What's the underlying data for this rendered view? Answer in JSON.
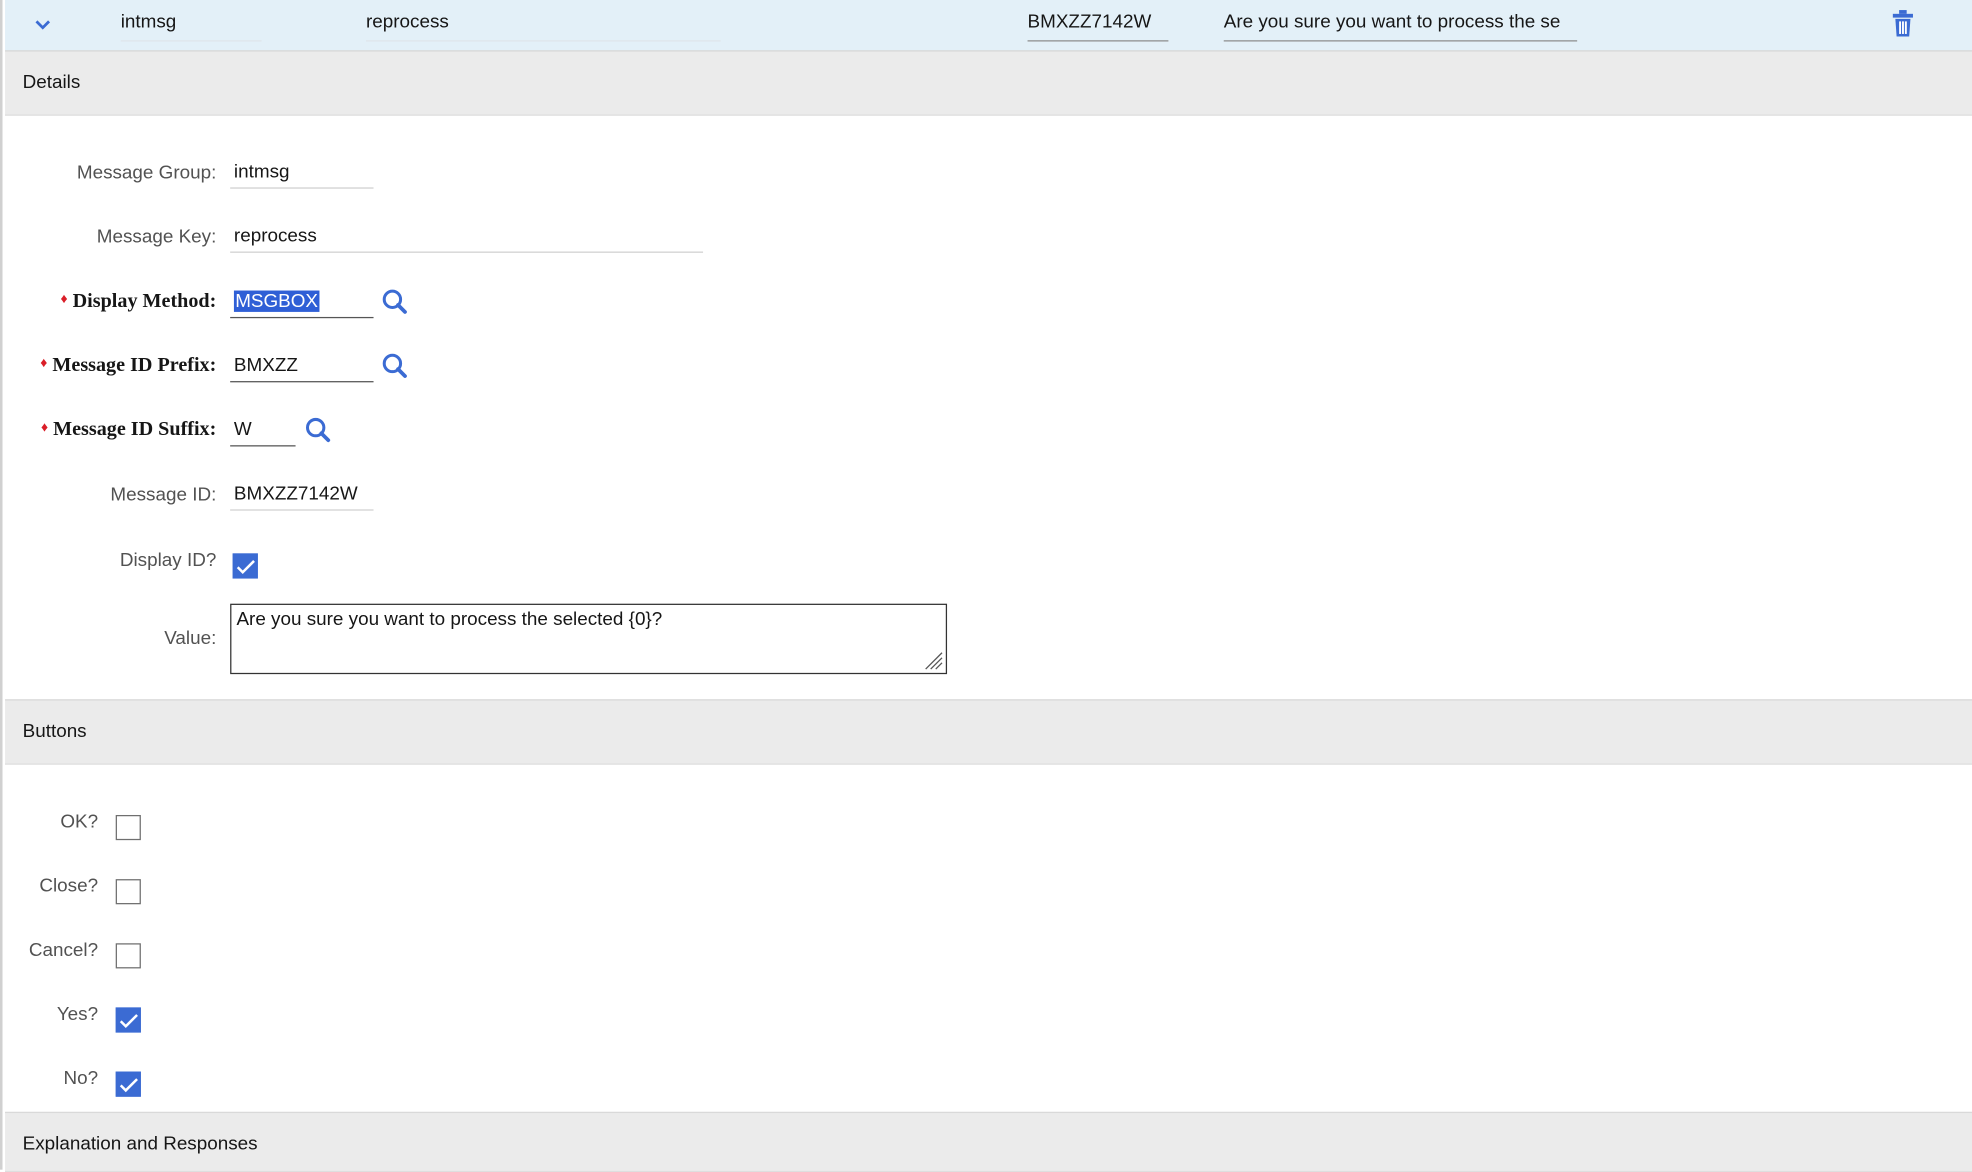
{
  "row": {
    "group": "intmsg",
    "key": "reprocess",
    "message_id": "BMXZZ7142W",
    "value_preview": "Are you sure you want to process the se"
  },
  "sections": {
    "details": "Details",
    "buttons": "Buttons",
    "explanation": "Explanation and Responses"
  },
  "details": {
    "message_group": {
      "label": "Message Group:",
      "value": "intmsg"
    },
    "message_key": {
      "label": "Message Key:",
      "value": "reprocess"
    },
    "display_method": {
      "label": "Display Method:",
      "value": "MSGBOX",
      "required": true
    },
    "id_prefix": {
      "label": "Message ID Prefix:",
      "value": "BMXZZ",
      "required": true
    },
    "id_suffix": {
      "label": "Message ID Suffix:",
      "value": "W",
      "required": true
    },
    "message_id": {
      "label": "Message ID:",
      "value": "BMXZZ7142W"
    },
    "display_id": {
      "label": "Display ID?",
      "checked": true
    },
    "value": {
      "label": "Value:",
      "text": "Are you sure you want to process the selected {0}?"
    }
  },
  "buttons": [
    {
      "label": "OK?",
      "checked": false
    },
    {
      "label": "Close?",
      "checked": false
    },
    {
      "label": "Cancel?",
      "checked": false
    },
    {
      "label": "Yes?",
      "checked": true
    },
    {
      "label": "No?",
      "checked": true
    }
  ],
  "colors": {
    "row_highlight": "#e3f0f8",
    "section_bg": "#ebebeb",
    "accent": "#3b6bd3",
    "required": "#da1e28"
  },
  "icons": [
    "chevron-down-icon",
    "trash-icon",
    "search-icon",
    "checkmark-icon",
    "resize-grip-icon"
  ]
}
